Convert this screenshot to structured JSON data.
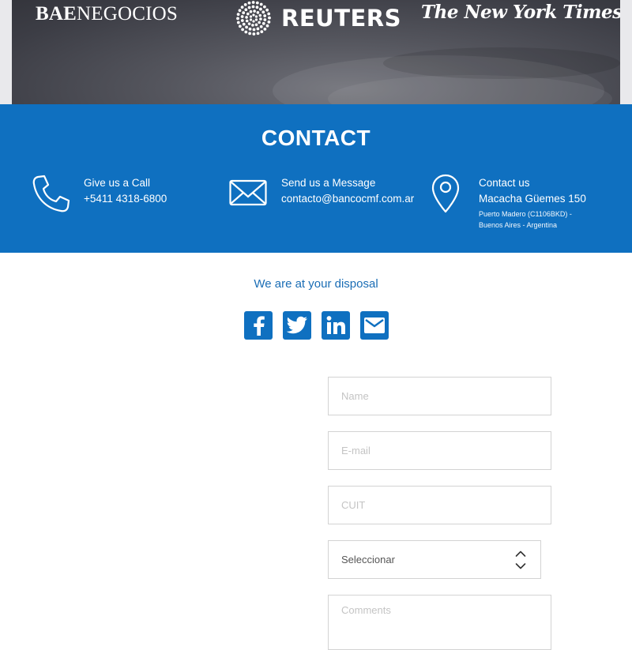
{
  "press": {
    "bae_bold": "BAE",
    "bae_rest": "NEGOCIOS",
    "reuters": "REUTERS",
    "nyt": "The New York Times"
  },
  "contact": {
    "title": "CONTACT",
    "call": {
      "label": "Give us a Call",
      "value": "+5411 4318-6800",
      "icon": "phone-icon"
    },
    "message": {
      "label": "Send us a Message",
      "value": "contacto@bancocmf.com.ar",
      "icon": "envelope-icon"
    },
    "address": {
      "label": "Contact us",
      "value": "Macacha Güemes 150",
      "sub1": "Puerto Madero (C1106BKD) -",
      "sub2": "Buenos Aires - Argentina",
      "icon": "map-pin-icon"
    }
  },
  "disposal": {
    "text": "We are at your disposal"
  },
  "social": [
    "facebook-icon",
    "twitter-icon",
    "linkedin-icon",
    "mail-icon"
  ],
  "form": {
    "name_placeholder": "Name",
    "email_placeholder": "E-mail",
    "cuit_placeholder": "CUIT",
    "select_value": "Seleccionar",
    "comments_placeholder": "Comments"
  },
  "colors": {
    "brand_blue": "#0f70c0",
    "text_blue": "#1a6db5",
    "border": "#d3d3d3",
    "placeholder": "#c4c4c4"
  }
}
